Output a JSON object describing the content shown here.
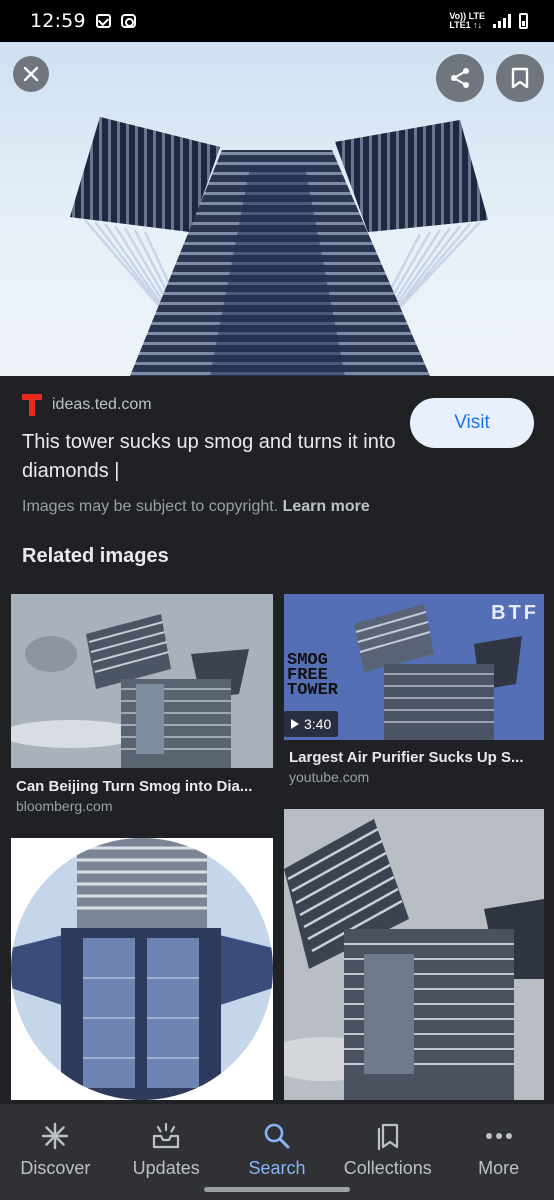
{
  "status_bar": {
    "time": "12:59",
    "icons": [
      "gmail-icon",
      "instagram-icon"
    ],
    "network_top": "Vo)) LTE",
    "network_bottom": "LTE1 ↑↓"
  },
  "hero": {
    "image": "smog-free-tower-upward-view",
    "close_icon": "close-icon",
    "share_icon": "share-icon",
    "save_icon": "bookmark-icon"
  },
  "result": {
    "source_logo": "ted-logo",
    "source_domain": "ideas.ted.com",
    "title": "This tower sucks up smog and turns it into diamonds |",
    "visit_label": "Visit",
    "copyright_text": "Images may be subject to copyright.",
    "learn_more_label": "Learn more"
  },
  "related": {
    "heading": "Related images",
    "items": [
      {
        "title": "Can Beijing Turn Smog into Dia...",
        "source": "bloomberg.com"
      },
      {
        "title": "Largest Air Purifier Sucks Up S...",
        "source": "youtube.com",
        "duration": "3:40",
        "overlay_lines": [
          "SMOG",
          "FREE",
          "TOWER"
        ],
        "badge": "BTF"
      },
      {
        "title": "",
        "source": ""
      },
      {
        "title": "",
        "source": ""
      }
    ]
  },
  "bottom_nav": {
    "items": [
      {
        "label": "Discover",
        "icon": "asterisk-icon",
        "active": false
      },
      {
        "label": "Updates",
        "icon": "inbox-bell-icon",
        "active": false
      },
      {
        "label": "Search",
        "icon": "search-icon",
        "active": true
      },
      {
        "label": "Collections",
        "icon": "collections-icon",
        "active": false
      },
      {
        "label": "More",
        "icon": "more-dots-icon",
        "active": false
      }
    ]
  },
  "colors": {
    "background": "#202124",
    "accent": "#8ab4f8",
    "visit_bg": "#e8f0fe",
    "visit_text": "#1a73e8",
    "ted_red": "#e62b1e"
  }
}
